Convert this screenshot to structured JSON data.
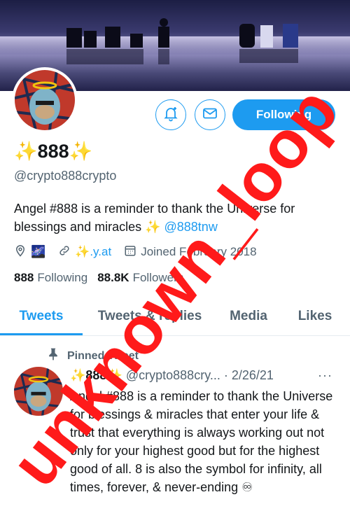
{
  "profile": {
    "display_name": "✨888✨",
    "handle": "@crypto888crypto",
    "bio_text": "Angel #888 is a reminder to thank the Universe for blessings and miracles ✨ ",
    "bio_link": "@888tnw",
    "location_emoji": "🌌",
    "website": "✨.y.at",
    "joined": "Joined February 2018",
    "following_count": "888",
    "following_label": "Following",
    "followers_count": "88.8K",
    "followers_label": "Followers"
  },
  "buttons": {
    "follow_label": "Following"
  },
  "tabs": [
    "Tweets",
    "Tweets & replies",
    "Media",
    "Likes"
  ],
  "tweet": {
    "pinned_label": "Pinned Tweet",
    "author_name": "✨888✨",
    "author_handle": "@crypto888cry...",
    "date": "· 2/26/21",
    "more": "···",
    "text": "Angel #888 is a reminder to thank the Universe for blessings & miracles that enter your life & trust that everything is always working out not only for your highest good but for the highest good of all. 8 is also the symbol for infinity, all times, forever, & never-ending ♾"
  },
  "overlay": {
    "stamp_text": "unknown_loop"
  },
  "colors": {
    "accent": "#1d9bf0",
    "stamp": "#ff1a1a"
  },
  "icons": [
    "notification-bell-icon",
    "mail-icon",
    "location-icon",
    "link-icon",
    "calendar-icon",
    "pin-icon"
  ]
}
